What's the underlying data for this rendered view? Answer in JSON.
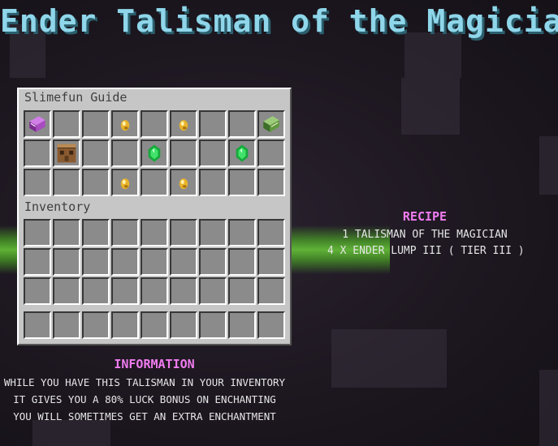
{
  "title": "Ender Talisman of the Magician",
  "gui": {
    "guide_label": "Slimefun Guide",
    "inventory_label": "Inventory",
    "guide_slots": [
      "enchanted-book-icon",
      "",
      "",
      "gold-nugget-icon",
      "",
      "gold-nugget-icon",
      "",
      "",
      "green-book-icon",
      "",
      "crafting-table-icon",
      "",
      "",
      "emerald-icon",
      "",
      "",
      "emerald-icon",
      "",
      "",
      "",
      "",
      "gold-nugget-icon",
      "",
      "gold-nugget-icon",
      "",
      "",
      ""
    ],
    "inventory_rows": 3,
    "hotbar_rows": 1,
    "columns": 9
  },
  "recipe": {
    "heading": "RECIPE",
    "lines": [
      "1 TALISMAN OF THE MAGICIAN",
      "4 X ENDER LUMP III ( TIER III )"
    ]
  },
  "information": {
    "heading": "INFORMATION",
    "lines": [
      "WHILE YOU HAVE THIS TALISMAN IN YOUR INVENTORY",
      "IT GIVES YOU A 80%  LUCK BONUS ON ENCHANTING",
      "YOU WILL SOMETIMES GET AN EXTRA ENCHANTMENT"
    ]
  },
  "colors": {
    "title": "#8fd6ea",
    "heading": "#f07cf0",
    "text": "#e6e6e6",
    "gui": "#c6c6c6",
    "slot": "#8b8b8b"
  }
}
